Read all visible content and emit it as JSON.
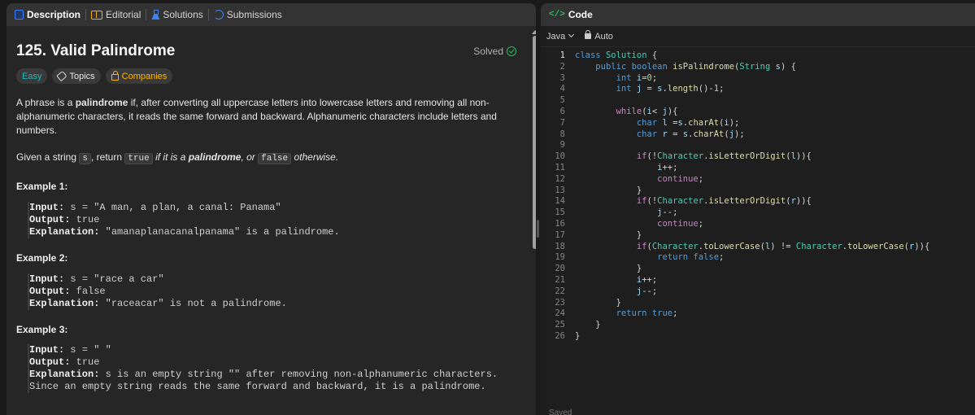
{
  "left_tabs": [
    {
      "label": "Description",
      "icon": "description-icon"
    },
    {
      "label": "Editorial",
      "icon": "book-icon"
    },
    {
      "label": "Solutions",
      "icon": "flask-icon"
    },
    {
      "label": "Submissions",
      "icon": "history-icon"
    }
  ],
  "problem": {
    "title": "125. Valid Palindrome",
    "status": "Solved",
    "tags": {
      "difficulty": "Easy",
      "topics": "Topics",
      "companies": "Companies"
    },
    "description_p1_a": "A phrase is a ",
    "description_p1_b": "palindrome",
    "description_p1_c": " if, after converting all uppercase letters into lowercase letters and removing all non-alphanumeric characters, it reads the same forward and backward. Alphanumeric characters include letters and numbers.",
    "description_p2_a": "Given a string ",
    "description_p2_s": "s",
    "description_p2_b": ", return ",
    "description_p2_true": "true",
    "description_p2_c": " if it is a ",
    "description_p2_pal": "palindrome",
    "description_p2_d": ", or ",
    "description_p2_false": "false",
    "description_p2_e": " otherwise."
  },
  "examples": [
    {
      "title": "Example 1:",
      "input_label": "Input:",
      "input": " s = \"A man, a plan, a canal: Panama\"",
      "output_label": "Output:",
      "output": " true",
      "explanation_label": "Explanation:",
      "explanation": " \"amanaplanacanalpanama\" is a palindrome."
    },
    {
      "title": "Example 2:",
      "input_label": "Input:",
      "input": " s = \"race a car\"",
      "output_label": "Output:",
      "output": " false",
      "explanation_label": "Explanation:",
      "explanation": " \"raceacar\" is not a palindrome."
    },
    {
      "title": "Example 3:",
      "input_label": "Input:",
      "input": " s = \" \"",
      "output_label": "Output:",
      "output": " true",
      "explanation_label": "Explanation:",
      "explanation": " s is an empty string \"\" after removing non-alphanumeric characters.",
      "explanation_2": "Since an empty string reads the same forward and backward, it is a palindrome."
    }
  ],
  "code_panel": {
    "title": "Code",
    "language": "Java",
    "mode": "Auto",
    "footer": "Saved"
  },
  "code_lines": [
    "class Solution {",
    "    public boolean isPalindrome(String s) {",
    "        int i=0;",
    "        int j = s.length()-1;",
    "",
    "        while(i< j){",
    "            char l =s.charAt(i);",
    "            char r = s.charAt(j);",
    "",
    "            if(!Character.isLetterOrDigit(l)){",
    "                i++;",
    "                continue;",
    "            }",
    "            if(!Character.isLetterOrDigit(r)){",
    "                j--;",
    "                continue;",
    "            }",
    "            if(Character.toLowerCase(l) != Character.toLowerCase(r)){",
    "                return false;",
    "            }",
    "            i++;",
    "            j--;",
    "        }",
    "        return true;",
    "    }",
    "}"
  ],
  "colors": {
    "accent_green": "#2cbb5d",
    "easy": "#1cbaba",
    "companies": "#ffb700",
    "tab_blue": "#3b82f6"
  }
}
